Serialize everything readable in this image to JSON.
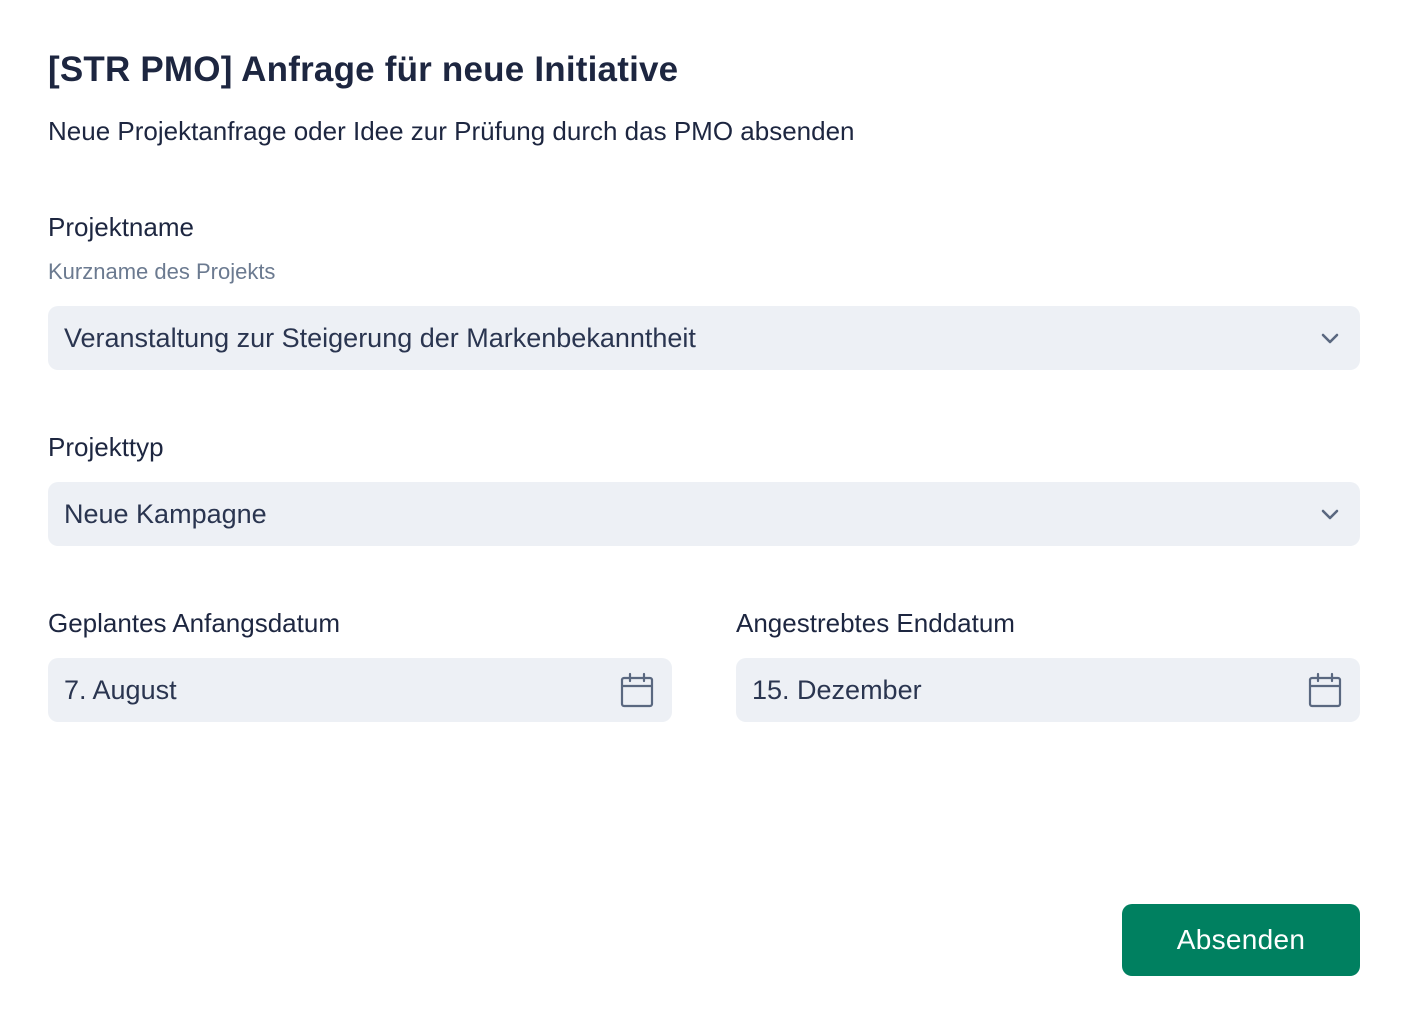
{
  "header": {
    "title": "[STR PMO] Anfrage für neue Initiative",
    "subtitle": "Neue Projektanfrage oder Idee zur Prüfung durch das PMO absenden"
  },
  "fields": {
    "project_name": {
      "label": "Projektname",
      "hint": "Kurzname des Projekts",
      "value": "Veranstaltung zur Steigerung der Markenbekanntheit",
      "icon": "chevron-down-icon"
    },
    "project_type": {
      "label": "Projekttyp",
      "value": "Neue Kampagne",
      "icon": "chevron-down-icon"
    },
    "start_date": {
      "label": "Geplantes Anfangsdatum",
      "value": "7. August",
      "icon": "calendar-icon"
    },
    "end_date": {
      "label": "Angestrebtes Enddatum",
      "value": "15. Dezember",
      "icon": "calendar-icon"
    }
  },
  "actions": {
    "submit_label": "Absenden"
  },
  "colors": {
    "primary": "#008060",
    "field_background": "#edf0f5",
    "text": "#1d2640",
    "hint_text": "#6b7a90"
  }
}
